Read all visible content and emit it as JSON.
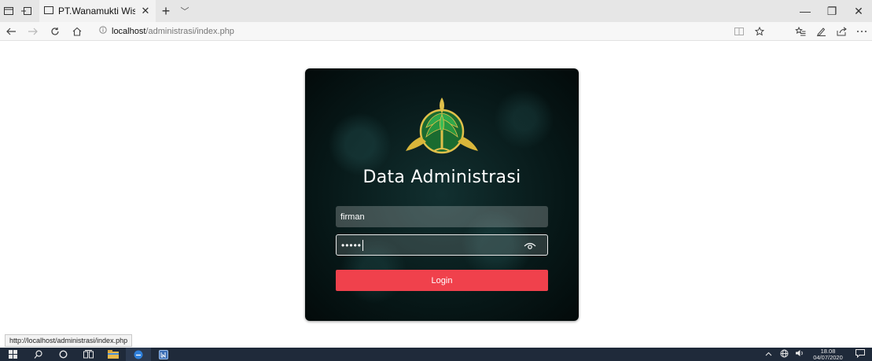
{
  "browser": {
    "tab_title": "PT.Wanamukti Wisesa T",
    "tab_close": "✕",
    "new_tab": "+",
    "tab_menu": "﹀",
    "window_controls": {
      "minimize": "—",
      "restore": "❐",
      "close": "✕"
    },
    "address": {
      "host": "localhost",
      "path": "/administrasi/index.php"
    },
    "icons": [
      "tab-preview-icon",
      "set-aside-tabs-icon",
      "page-icon",
      "back-icon",
      "forward-icon",
      "refresh-icon",
      "home-icon",
      "info-icon",
      "reading-view-icon",
      "favorite-star-icon",
      "favorites-icon",
      "pen-icon",
      "share-icon",
      "more-icon"
    ]
  },
  "login": {
    "title": "Data Administrasi",
    "username_value": "firman",
    "password_mask": "•••••",
    "button_label": "Login",
    "colors": {
      "button": "#f0414c",
      "logo_green": "#1f8a3a",
      "logo_gold": "#d9b63a"
    }
  },
  "status_bar": {
    "url": "http://localhost/administrasi/index.php"
  },
  "taskbar": {
    "time": "18.08",
    "date": "04/07/2020",
    "icons": [
      "windows-start-icon",
      "search-icon",
      "cortana-icon",
      "task-view-icon",
      "file-explorer-icon",
      "edge-icon",
      "app-icon",
      "chevron-up-icon",
      "network-icon",
      "volume-icon",
      "notification-icon"
    ]
  }
}
